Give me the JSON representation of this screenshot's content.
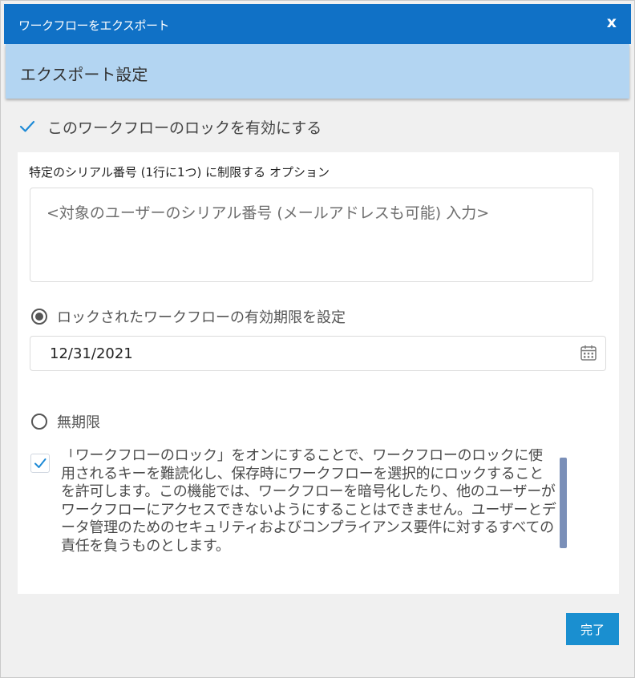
{
  "dialog": {
    "title": "ワークフローをエクスポート",
    "close_label": "x"
  },
  "section": {
    "header": "エクスポート設定"
  },
  "lock_option": {
    "checked": true,
    "label": "このワークフローのロックを有効にする"
  },
  "serial": {
    "label": "特定のシリアル番号 (1行に1つ) に制限する オプション",
    "placeholder": "<対象のユーザーのシリアル番号 (メールアドレスも可能) 入力>"
  },
  "expiry": {
    "set_expiry_label": "ロックされたワークフローの有効期限を設定",
    "set_expiry_selected": true,
    "date_value": "12/31/2021",
    "no_expiry_label": "無期限",
    "no_expiry_selected": false
  },
  "notice": {
    "checked": true,
    "text": "「ワークフローのロック」をオンにすることで、ワークフローのロックに使用されるキーを難読化し、保存時にワークフローを選択的にロックすることを許可します。この機能では、ワークフローを暗号化したり、他のユーザーがワークフローにアクセスできないようにすることはできません。ユーザーとデータ管理のためのセキュリティおよびコンプライアンス要件に対するすべての責任を負うものとします。"
  },
  "footer": {
    "done_label": "完了"
  },
  "colors": {
    "titlebar": "#1071c6",
    "section_header": "#b3d5f2",
    "accent": "#1a8fd0",
    "scroll_thumb": "#7a8fb8"
  }
}
